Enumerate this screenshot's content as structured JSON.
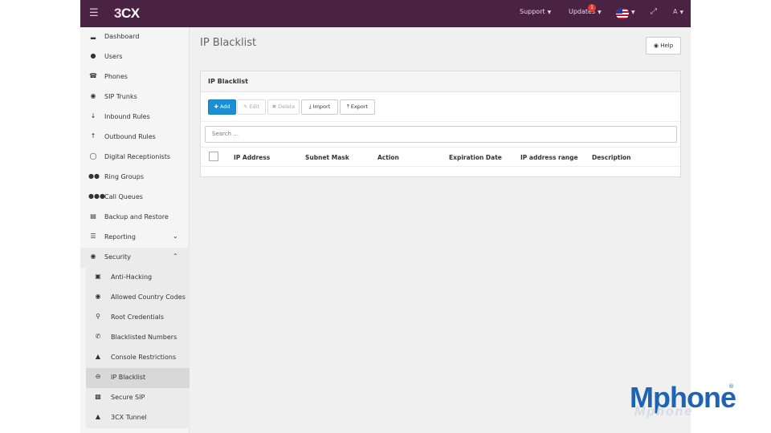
{
  "header": {
    "menu_icon": "hamburger-icon",
    "logo_prefix": "3",
    "logo_suffix": "CX",
    "support_label": "Support",
    "updates_label": "Updates",
    "updates_count": "1",
    "language": "en-US flag",
    "expand_icon": "fullscreen-icon",
    "user_label": "A",
    "colors": {
      "bar": "#4a2343",
      "badge": "#e23b2f"
    }
  },
  "sidebar": {
    "items": [
      {
        "label": "Dashboard",
        "icon": "bar-chart-icon"
      },
      {
        "label": "Users",
        "icon": "user-icon"
      },
      {
        "label": "Phones",
        "icon": "phone-icon"
      },
      {
        "label": "SIP Trunks",
        "icon": "globe-icon"
      },
      {
        "label": "Inbound Rules",
        "icon": "arrow-down-icon"
      },
      {
        "label": "Outbound Rules",
        "icon": "arrow-up-icon"
      },
      {
        "label": "Digital Receptionists",
        "icon": "headset-icon"
      },
      {
        "label": "Ring Groups",
        "icon": "group-icon"
      },
      {
        "label": "Call Queues",
        "icon": "users-icon"
      },
      {
        "label": "Backup and Restore",
        "icon": "database-icon"
      },
      {
        "label": "Reporting",
        "icon": "list-icon"
      },
      {
        "label": "Security",
        "icon": "shield-icon"
      }
    ],
    "security_sub": [
      {
        "label": "Anti-Hacking",
        "icon": "briefcase-icon"
      },
      {
        "label": "Allowed Country Codes",
        "icon": "globe-icon"
      },
      {
        "label": "Root Credentials",
        "icon": "key-icon"
      },
      {
        "label": "Blacklisted Numbers",
        "icon": "phone-icon"
      },
      {
        "label": "Console Restrictions",
        "icon": "warning-icon"
      },
      {
        "label": "IP Blacklist",
        "icon": "minus-circle-icon"
      },
      {
        "label": "Secure SIP",
        "icon": "lock-icon"
      },
      {
        "label": "3CX Tunnel",
        "icon": "road-icon"
      }
    ],
    "active_item": "IP Blacklist"
  },
  "main": {
    "title": "IP Blacklist",
    "help_label": "Help",
    "panel_title": "IP Blacklist",
    "toolbar": {
      "add": "Add",
      "edit": "Edit",
      "delete": "Delete",
      "import": "Import",
      "export": "Export"
    },
    "search_placeholder": "Search ...",
    "columns": [
      "IP Address",
      "Subnet Mask",
      "Action",
      "Expiration Date",
      "IP address range",
      "Description"
    ],
    "rows": [],
    "accent_color": "#1a8fd5"
  },
  "watermark": {
    "brand": "Mphone",
    "registered": "®",
    "reflection": "Mphone"
  }
}
